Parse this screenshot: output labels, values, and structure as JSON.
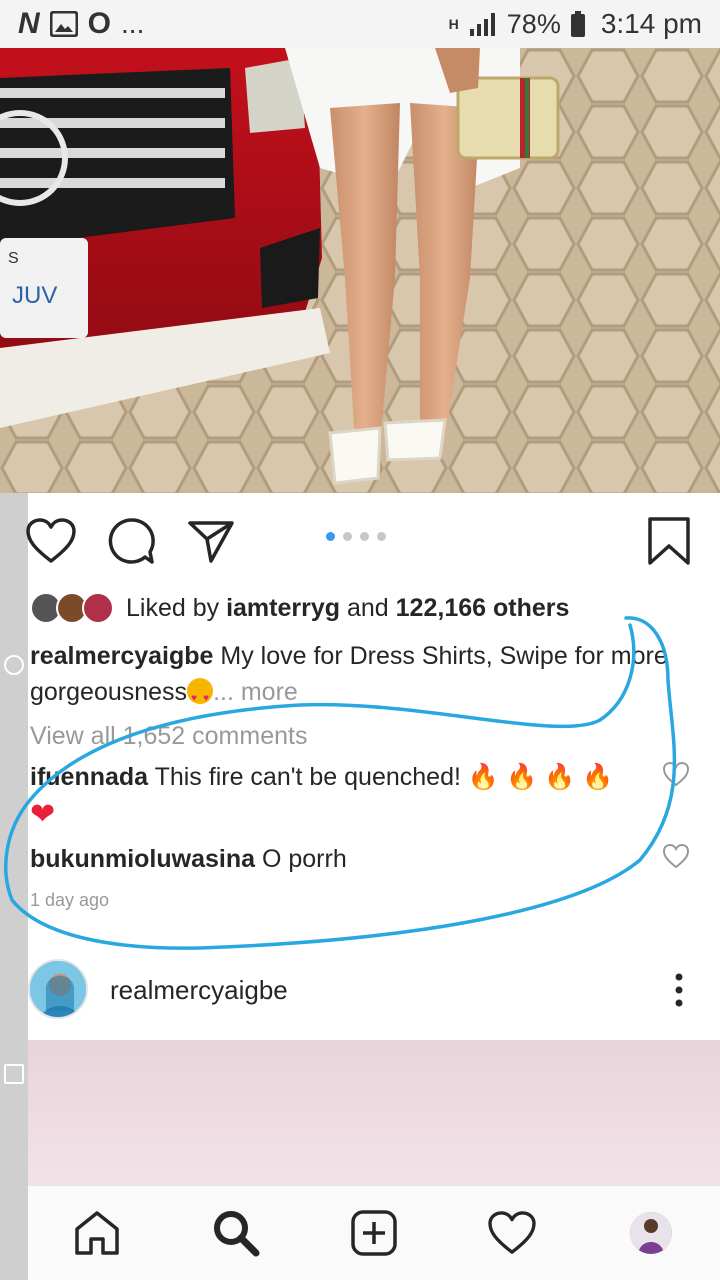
{
  "status_bar": {
    "left_icons": [
      "N",
      "gallery-icon",
      "O",
      "..."
    ],
    "network": "H",
    "battery": "78%",
    "time": "3:14 pm"
  },
  "post": {
    "carousel": {
      "count": 4,
      "active": 1
    },
    "likes": {
      "prefix": "Liked by",
      "user": "iamterryg",
      "middle": "and",
      "others": "122,166 others"
    },
    "caption": {
      "user": "realmercyaigbe",
      "text": "My love for Dress Shirts, Swipe for more gorgeousness",
      "more": "... more"
    },
    "view_all": "View all 1,652 comments",
    "comments": [
      {
        "user": "ifuennada",
        "text": "This fire can't be quenched!",
        "emojis": "🔥 🔥 🔥 🔥",
        "emoji2": "❤"
      },
      {
        "user": "bukunmioluwasina",
        "text": "O porrh"
      }
    ],
    "time_ago": "1 day ago"
  },
  "next_post": {
    "user": "realmercyaigbe"
  },
  "colors": {
    "accent_blue": "#3897f0",
    "annotation": "#29a8e0",
    "fire": "#ff5a00",
    "heart": "#e8203a"
  }
}
